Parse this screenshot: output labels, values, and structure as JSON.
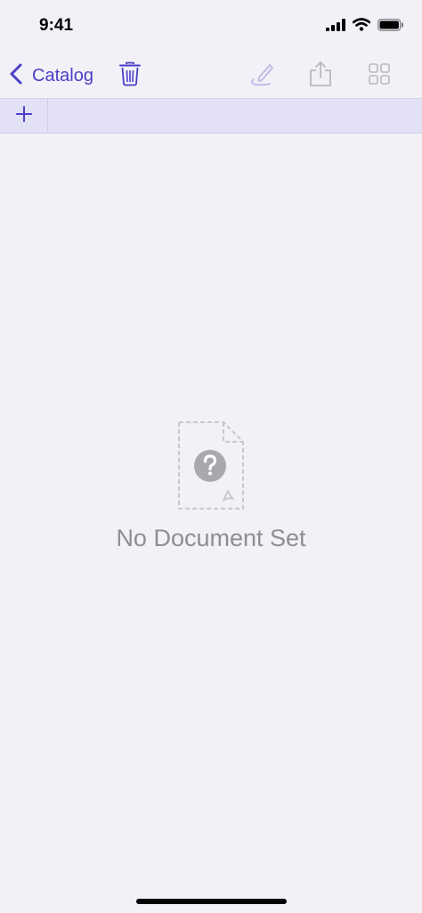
{
  "status_bar": {
    "time": "9:41",
    "icons": [
      "cellular-signal-icon",
      "wifi-icon",
      "battery-icon"
    ]
  },
  "nav": {
    "back_label": "Catalog",
    "icons": [
      "chevron-left-icon",
      "trash-icon",
      "annotate-pen-icon",
      "share-icon",
      "grid-view-icon"
    ]
  },
  "tab_strip": {
    "add_icon": "plus-icon"
  },
  "empty_state": {
    "icon": "missing-document-icon",
    "label": "No Document Set"
  },
  "colors": {
    "accent": "#4A3FC8",
    "background": "#F2F1F7",
    "tab_strip": "#E3E1F6",
    "disabled_icon": "#B9B9BF",
    "empty_text": "#8E8E93"
  }
}
